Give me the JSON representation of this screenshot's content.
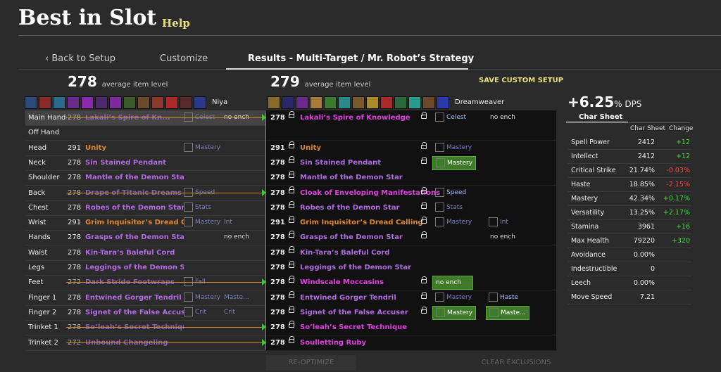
{
  "app": {
    "title": "Best in Slot",
    "help": "Help"
  },
  "tabs": {
    "back": "Back to Setup",
    "customize": "Customize",
    "results": "Results - Multi-Target / Mr. Robot’s Strategy"
  },
  "left": {
    "ilvl": "278",
    "ilvl_label": "average item level",
    "char": "Niya"
  },
  "right": {
    "ilvl": "279",
    "ilvl_label": "average item level",
    "char": "Dreamweaver",
    "save": "SAVE CUSTOM SETUP"
  },
  "dps": {
    "value": "+6.25",
    "unit": "% DPS"
  },
  "charsheet": {
    "title": "Char Sheet",
    "col1": "Char Sheet",
    "col2": "Change",
    "stats": [
      {
        "k": "Spell Power",
        "v": "2412",
        "c": "+12",
        "pos": true
      },
      {
        "k": "Intellect",
        "v": "2412",
        "c": "+12",
        "pos": true
      },
      {
        "k": "Critical Strike",
        "v": "21.74%",
        "c": "-0.03%",
        "pos": false
      },
      {
        "k": "Haste",
        "v": "18.85%",
        "c": "-2.15%",
        "pos": false
      },
      {
        "k": "Mastery",
        "v": "42.34%",
        "c": "+0.17%",
        "pos": true
      },
      {
        "k": "Versatility",
        "v": "13.25%",
        "c": "+2.17%",
        "pos": true
      },
      {
        "k": "Stamina",
        "v": "3961",
        "c": "+16",
        "pos": true
      },
      {
        "k": "Max Health",
        "v": "79220",
        "c": "+320",
        "pos": true
      },
      {
        "k": "Avoidance",
        "v": "0.00%",
        "c": "",
        "pos": true
      },
      {
        "k": "Indestructible",
        "v": "0",
        "c": "",
        "pos": true
      },
      {
        "k": "Leech",
        "v": "0.00%",
        "c": "",
        "pos": true
      },
      {
        "k": "Move Speed",
        "v": "7.21",
        "c": "",
        "pos": true
      }
    ]
  },
  "slots": [
    {
      "slot": "Main Hand",
      "lvl": "278",
      "name": "Lakali’s Spire of Kn...",
      "strike": true,
      "color": "#b06be0",
      "tag": "Celest",
      "tag2": "no ench",
      "rlvl": "278",
      "rname": "Lakali’s Spire of Knowledge",
      "rcolor": "#e040e0",
      "rtag": "Celest",
      "rtag2": "no ench"
    },
    {
      "slot": "Off Hand",
      "lvl": "",
      "name": "",
      "strike": false,
      "color": "#fff",
      "tag": "",
      "tag2": "",
      "rlvl": "",
      "rname": "",
      "rcolor": "#fff",
      "rtag": "",
      "rtag2": ""
    },
    {
      "slot": "Head",
      "lvl": "291",
      "name": "Unity",
      "strike": false,
      "color": "#e0862a",
      "tag": "Mastery",
      "tag2": "",
      "rlvl": "291",
      "rname": "Unity",
      "rcolor": "#e0862a",
      "rtag": "Mastery",
      "rtag2": ""
    },
    {
      "slot": "Neck",
      "lvl": "278",
      "name": "Sin Stained Pendant",
      "strike": false,
      "color": "#b06be0",
      "tag": "",
      "tag2": "",
      "rlvl": "278",
      "rname": "Sin Stained Pendant",
      "rcolor": "#b06be0",
      "rtag": "Mastery",
      "rtag2": ""
    },
    {
      "slot": "Shoulder",
      "lvl": "278",
      "name": "Mantle of the Demon Star",
      "strike": false,
      "color": "#b06be0",
      "tag": "",
      "tag2": "",
      "rlvl": "278",
      "rname": "Mantle of the Demon Star",
      "rcolor": "#b06be0",
      "rtag": "",
      "rtag2": ""
    },
    {
      "slot": "Back",
      "lvl": "278",
      "name": "Drape of Titanic Dreams",
      "strike": true,
      "color": "#b06be0",
      "tag": "Speed",
      "tag2": "",
      "rlvl": "278",
      "rname": "Cloak of Enveloping Manifestations",
      "rcolor": "#e040e0",
      "rtag": "Speed",
      "rtag2": ""
    },
    {
      "slot": "Chest",
      "lvl": "278",
      "name": "Robes of the Demon Star",
      "strike": false,
      "color": "#b06be0",
      "tag": "Stats",
      "tag2": "",
      "rlvl": "278",
      "rname": "Robes of the Demon Star",
      "rcolor": "#b06be0",
      "rtag": "Stats",
      "rtag2": ""
    },
    {
      "slot": "Wrist",
      "lvl": "291",
      "name": "Grim Inquisitor’s Dread Cal...",
      "strike": false,
      "color": "#e0862a",
      "tag": "Mastery",
      "tag2": "Int",
      "rlvl": "291",
      "rname": "Grim Inquisitor’s Dread Calling",
      "rcolor": "#e0862a",
      "rtag": "Mastery",
      "rtag2": "Int"
    },
    {
      "slot": "Hands",
      "lvl": "278",
      "name": "Grasps of the Demon Star",
      "strike": false,
      "color": "#b06be0",
      "tag": "",
      "tag2": "no ench",
      "rlvl": "278",
      "rname": "Grasps of the Demon Star",
      "rcolor": "#b06be0",
      "rtag": "",
      "rtag2": "no ench"
    },
    {
      "slot": "Waist",
      "lvl": "278",
      "name": "Kin-Tara’s Baleful Cord",
      "strike": false,
      "color": "#b06be0",
      "tag": "",
      "tag2": "",
      "rlvl": "278",
      "rname": "Kin-Tara’s Baleful Cord",
      "rcolor": "#b06be0",
      "rtag": "",
      "rtag2": ""
    },
    {
      "slot": "Legs",
      "lvl": "278",
      "name": "Leggings of the Demon Star",
      "strike": false,
      "color": "#b06be0",
      "tag": "",
      "tag2": "",
      "rlvl": "278",
      "rname": "Leggings of the Demon Star",
      "rcolor": "#b06be0",
      "rtag": "",
      "rtag2": ""
    },
    {
      "slot": "Feet",
      "lvl": "272",
      "name": "Dark Stride Footwraps",
      "strike": true,
      "color": "#b06be0",
      "tag": "Fall",
      "tag2": "",
      "rlvl": "278",
      "rname": "Windscale Moccasins",
      "rcolor": "#e040e0",
      "rtag": "no ench",
      "rtag2": ""
    },
    {
      "slot": "Finger 1",
      "lvl": "278",
      "name": "Entwined Gorger Tendril",
      "strike": false,
      "color": "#b06be0",
      "tag": "Mastery",
      "tag2": "Maste...",
      "rlvl": "278",
      "rname": "Entwined Gorger Tendril",
      "rcolor": "#b06be0",
      "rtag": "Mastery",
      "rtag2": "Haste"
    },
    {
      "slot": "Finger 2",
      "lvl": "278",
      "name": "Signet of the False Accuser",
      "strike": false,
      "color": "#b06be0",
      "tag": "Crit",
      "tag2": "Crit",
      "rlvl": "278",
      "rname": "Signet of the False Accuser",
      "rcolor": "#b06be0",
      "rtag": "Mastery",
      "rtag2": "Maste..."
    },
    {
      "slot": "Trinket 1",
      "lvl": "278",
      "name": "So’leah’s Secret Technique",
      "strike": true,
      "color": "#b06be0",
      "tag": "",
      "tag2": "",
      "rlvl": "278",
      "rname": "So’leah’s Secret Technique",
      "rcolor": "#e040e0",
      "rtag": "",
      "rtag2": ""
    },
    {
      "slot": "Trinket 2",
      "lvl": "272",
      "name": "Unbound Changeling",
      "strike": true,
      "color": "#b06be0",
      "tag": "",
      "tag2": "",
      "rlvl": "278",
      "rname": "Soulletting Ruby",
      "rcolor": "#e040e0",
      "rtag": "",
      "rtag2": ""
    }
  ],
  "buttons": {
    "reopt": "RE-OPTIMIZE",
    "clear": "CLEAR EXCLUSIONS"
  }
}
